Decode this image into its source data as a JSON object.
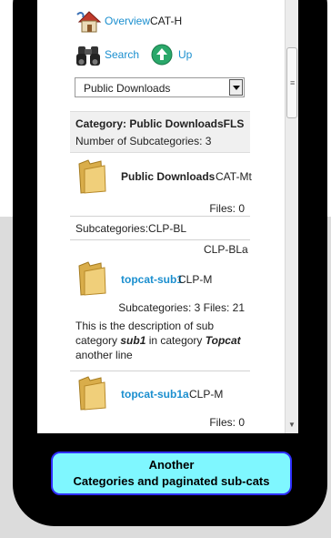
{
  "nav": {
    "overview_label": "Overview",
    "overview_code": "CAT-H",
    "search_label": "Search",
    "up_label": "Up"
  },
  "selector": {
    "value": "Public Downloads"
  },
  "category": {
    "title": "Category: Public DownloadsFLS",
    "subcount_text": "Number of Subcategories: 3"
  },
  "items": [
    {
      "title": "Public Downloads",
      "code": "CAT-Mt",
      "files_text": "Files: 0"
    }
  ],
  "subcats": {
    "label": "Subcategories:CLP-BL",
    "code_right": "CLP-BLa"
  },
  "subitems": [
    {
      "title": "topcat-sub1",
      "code": "CLP-M",
      "stats": "Subcategories: 3  Files: 21",
      "desc_pre": "This is the description of sub category ",
      "desc_b1": "sub1",
      "desc_mid": " in category ",
      "desc_b2": "Topcat",
      "desc_post": " another line"
    },
    {
      "title": "topcat-sub1a",
      "code": "CLP-M",
      "files_text": "Files: 0"
    }
  ],
  "caption": {
    "line1": "Another",
    "line2": "Categories and paginated sub-cats"
  },
  "colors": {
    "link": "#1b8fcf",
    "caption_bg": "#7ff7ff",
    "caption_border": "#2f2fff"
  }
}
